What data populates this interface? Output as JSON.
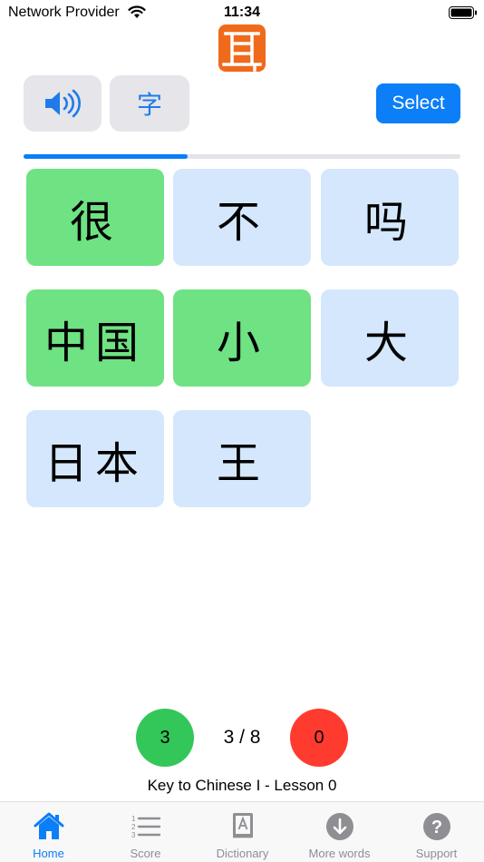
{
  "status_bar": {
    "carrier": "Network Provider",
    "time": "11:34"
  },
  "colors": {
    "accent": "#0b7ef8",
    "tile_default": "#d4e7fc",
    "tile_correct": "#6fe283",
    "score_correct": "#33c759",
    "score_wrong": "#ff3b30",
    "logo": "#f06a1c"
  },
  "toolbar": {
    "sound_icon": "speaker-wave-icon",
    "char_mode_label": "字",
    "select_label": "Select"
  },
  "progress": {
    "fraction": 0.375
  },
  "tiles": [
    {
      "text": "很",
      "state": "correct"
    },
    {
      "text": "不",
      "state": "default"
    },
    {
      "text": "吗",
      "state": "default"
    },
    {
      "text": "中国",
      "state": "correct"
    },
    {
      "text": "小",
      "state": "correct"
    },
    {
      "text": "大",
      "state": "default"
    },
    {
      "text": "日本",
      "state": "default"
    },
    {
      "text": "王",
      "state": "default"
    }
  ],
  "score": {
    "correct": "3",
    "wrong": "0",
    "count": "3 / 8"
  },
  "lesson": {
    "title": "Key to Chinese I - Lesson 0"
  },
  "tabs": [
    {
      "label": "Home",
      "icon": "home-icon",
      "active": true
    },
    {
      "label": "Score",
      "icon": "list-numbered-icon",
      "active": false
    },
    {
      "label": "Dictionary",
      "icon": "dictionary-book-icon",
      "active": false
    },
    {
      "label": "More words",
      "icon": "download-circle-icon",
      "active": false
    },
    {
      "label": "Support",
      "icon": "question-circle-icon",
      "active": false
    }
  ]
}
